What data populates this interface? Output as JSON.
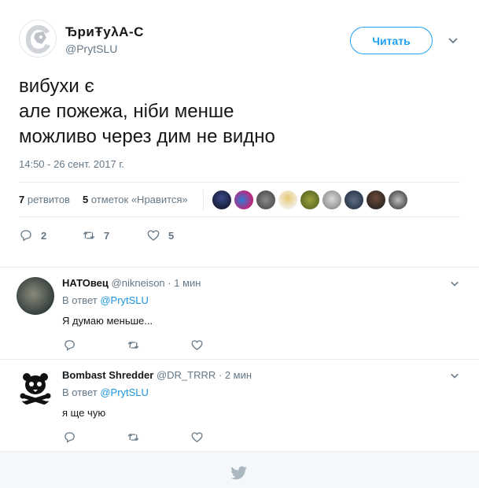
{
  "tweet": {
    "author_name": "ЂpиŦуλА-С",
    "author_handle": "@PrytSLU",
    "follow_label": "Читать",
    "text_lines": [
      "вибухи є",
      "але пожежа, ніби менше",
      "можливо через дим не видно"
    ],
    "timestamp": "14:50 - 26 сент. 2017 г.",
    "retweets_count": "7",
    "retweets_label": "ретвитов",
    "likes_count": "5",
    "likes_label": "отметок «Нравится»",
    "reply_count": "2",
    "retweet_action_count": "7",
    "like_action_count": "5"
  },
  "replies": [
    {
      "author_name": "НАТОвец",
      "author_handle": "@nikneison",
      "time": "· 1 мин",
      "in_reply_prefix": "В ответ",
      "in_reply_handle": "@PrytSLU",
      "text": "Я думаю меньше..."
    },
    {
      "author_name": "Bombast Shredder",
      "author_handle": "@DR_TRRR",
      "time": "· 2 мин",
      "in_reply_prefix": "В ответ",
      "in_reply_handle": "@PrytSLU",
      "text": "я ще чую"
    }
  ],
  "colors": {
    "accent": "#1da1f2",
    "link": "#1b95e0",
    "muted": "#657786",
    "text": "#14171a",
    "footer_bg": "#f5f8fa"
  }
}
